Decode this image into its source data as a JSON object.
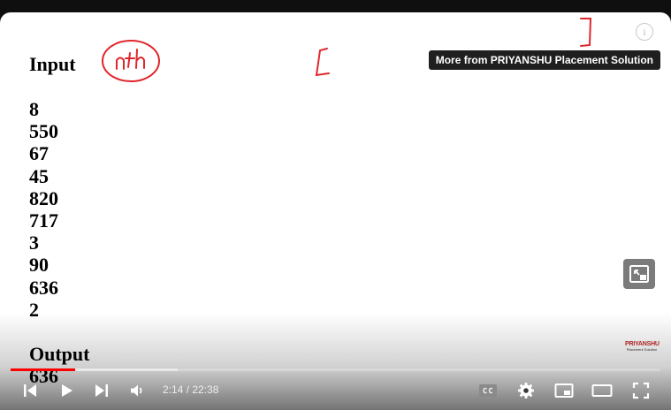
{
  "slide": {
    "input_heading": "Input",
    "numbers": [
      "8",
      "550",
      "67",
      "45",
      "820",
      "717",
      "3",
      "90",
      "636",
      "2"
    ],
    "output_heading": "Output",
    "output_value": "636"
  },
  "overlay": {
    "more_from": "More from PRIYANSHU Placement Solution",
    "info_icon": "i"
  },
  "channel": {
    "name": "PRIYANSHU",
    "subtitle": "Placement Solution"
  },
  "player": {
    "time_display": "2:14 / 22:38",
    "progress_fraction": 0.099,
    "buffered_fraction": 0.257,
    "accent_color": "#ff0000"
  },
  "icons": [
    "previous-icon",
    "play-icon",
    "next-icon",
    "volume-icon",
    "captions-icon",
    "settings-icon",
    "miniplayer-icon",
    "theater-icon",
    "fullscreen-icon",
    "info-icon"
  ]
}
